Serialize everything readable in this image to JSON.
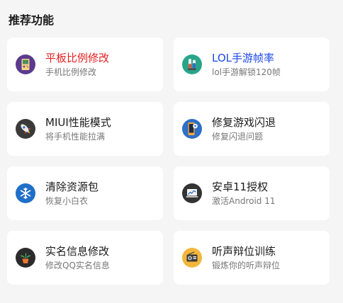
{
  "section": {
    "title": "推荐功能"
  },
  "cards": [
    {
      "title": "平板比例修改",
      "subtitle": "手机比例修改",
      "title_color": "#e61e1e",
      "icon": "gameboy-icon"
    },
    {
      "title": "LOL手游帧率",
      "subtitle": "lol手游解锁120帧",
      "title_color": "#1a47e8",
      "icon": "test-tubes-icon"
    },
    {
      "title": "MIUI性能模式",
      "subtitle": "将手机性能拉满",
      "icon": "rocket-icon"
    },
    {
      "title": "修复游戏闪退",
      "subtitle": "修复闪退问题",
      "icon": "phone-settings-icon"
    },
    {
      "title": "清除资源包",
      "subtitle": "恢复小白衣",
      "icon": "snowflake-icon"
    },
    {
      "title": "安卓11授权",
      "subtitle": "激活Android 11",
      "icon": "laptop-chart-icon"
    },
    {
      "title": "实名信息修改",
      "subtitle": "修改QQ实名信息",
      "icon": "plant-pot-icon"
    },
    {
      "title": "听声辩位训练",
      "subtitle": "锻炼你的听声辩位",
      "icon": "radio-icon"
    }
  ],
  "colors": {
    "highlight_red": "#e61e1e",
    "highlight_blue": "#1a47e8"
  }
}
